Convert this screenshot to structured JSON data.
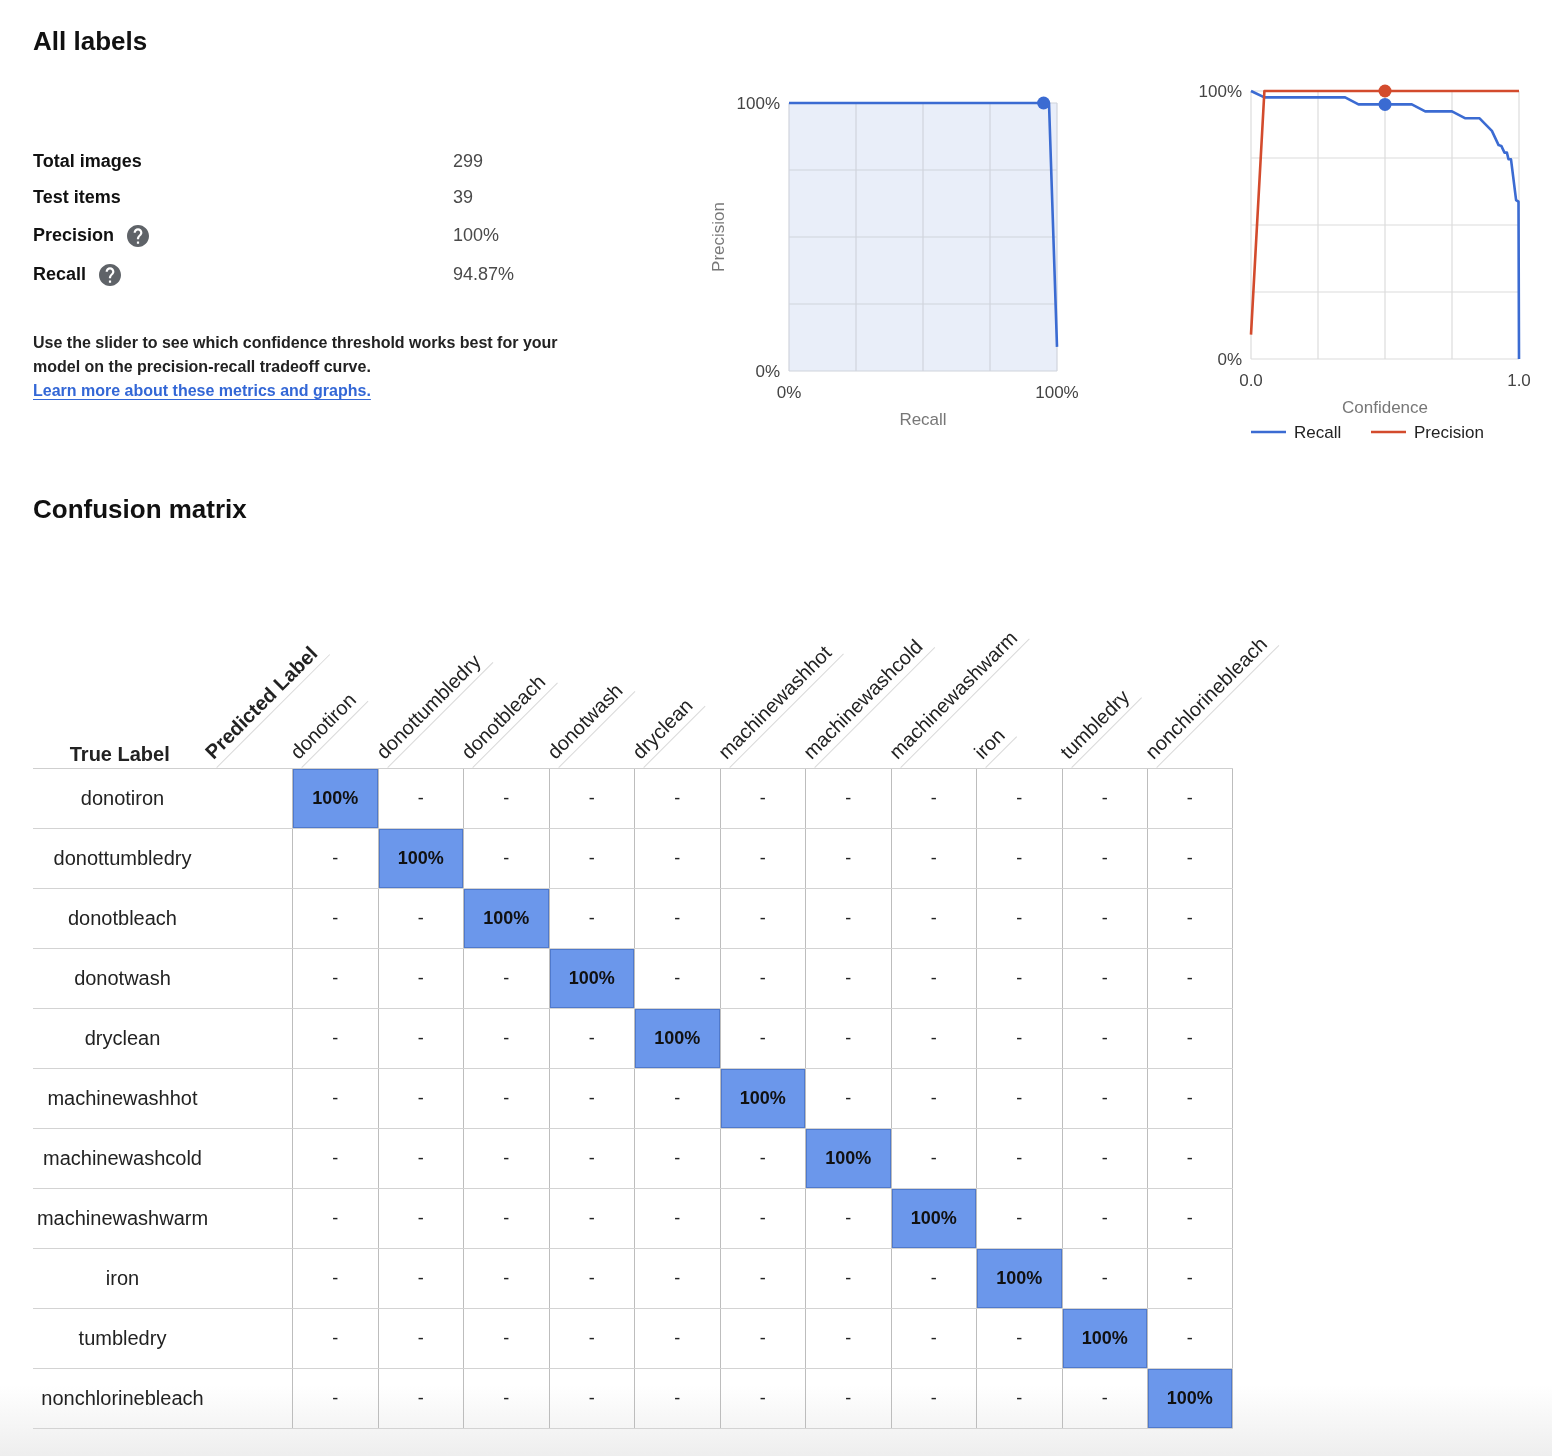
{
  "all_labels": {
    "title": "All labels",
    "metrics": [
      {
        "label": "Total images",
        "value": "299",
        "help": false
      },
      {
        "label": "Test items",
        "value": "39",
        "help": false
      },
      {
        "label": "Precision",
        "value": "100%",
        "help": true
      },
      {
        "label": "Recall",
        "value": "94.87%",
        "help": true
      }
    ],
    "description": "Use the slider to see which confidence threshold works best for your model on the precision-recall tradeoff curve.",
    "learn_more_link": "Learn more about these metrics and graphs.",
    "pr_curve": {
      "chart_data": {
        "type": "line",
        "xlabel": "Recall",
        "ylabel": "Precision",
        "x": [
          0,
          0.9487,
          0.97,
          1
        ],
        "series": [
          {
            "color": "#3b6bd2",
            "values": [
              1,
              1,
              1,
              0.09
            ]
          }
        ],
        "xlim": [
          0,
          1
        ],
        "ylim": [
          0,
          1
        ],
        "xticks": [
          {
            "value": 0,
            "label": "0%"
          },
          {
            "value": 1,
            "label": "100%"
          }
        ],
        "yticks": [
          {
            "value": 0,
            "label": "0%"
          },
          {
            "value": 1,
            "label": "100%"
          }
        ]
      }
    },
    "threshold_curve": {
      "chart_data": {
        "type": "line",
        "xlabel": "Confidence",
        "x": [
          0,
          0.05,
          0.351,
          0.401,
          0.6,
          0.65,
          0.75,
          0.8,
          0.853,
          0.899,
          0.924,
          0.934,
          0.946,
          0.955,
          0.961,
          0.97,
          0.989,
          0.998,
          1
        ],
        "series": [
          {
            "name": "Recall",
            "color": "#3b6bd2",
            "values": [
              1,
              0.976,
              0.976,
              0.95,
              0.95,
              0.924,
              0.924,
              0.898,
              0.898,
              0.851,
              0.798,
              0.795,
              0.77,
              0.77,
              0.745,
              0.745,
              0.593,
              0.587,
              0
            ]
          },
          {
            "name": "Precision",
            "color": "#d34b2d",
            "values": [
              0.091,
              1,
              1,
              1,
              1,
              1,
              1,
              1,
              1,
              1,
              1,
              1,
              1,
              1,
              1,
              1,
              1,
              1,
              1
            ]
          }
        ],
        "xlim": [
          0,
          1
        ],
        "ylim": [
          0,
          1
        ],
        "xticks": [
          {
            "value": 0,
            "label": "0.0"
          },
          {
            "value": 1,
            "label": "1.0"
          }
        ],
        "yticks": [
          {
            "value": 0,
            "label": "0%"
          },
          {
            "value": 1,
            "label": "100%"
          }
        ],
        "legend": "bottom"
      },
      "threshold_slider": {
        "level": 0.5
      }
    }
  },
  "confusion_matrix": {
    "title": "Confusion matrix",
    "corner_label": "True Label",
    "axis_label": "Predicted Label",
    "columns": [
      "donotiron",
      "donottumbledry",
      "donotbleach",
      "donotwash",
      "dryclean",
      "machinewashhot",
      "machinewashcold",
      "machinewashwarm",
      "iron",
      "tumbledry",
      "nonchlorinebleach"
    ],
    "rows": [
      {
        "label": "donotiron",
        "cells": [
          {
            "text": "100%",
            "highlighted": true
          },
          {
            "text": "-",
            "highlighted": false
          },
          {
            "text": "-",
            "highlighted": false
          },
          {
            "text": "-",
            "highlighted": false
          },
          {
            "text": "-",
            "highlighted": false
          },
          {
            "text": "-",
            "highlighted": false
          },
          {
            "text": "-",
            "highlighted": false
          },
          {
            "text": "-",
            "highlighted": false
          },
          {
            "text": "-",
            "highlighted": false
          },
          {
            "text": "-",
            "highlighted": false
          },
          {
            "text": "-",
            "highlighted": false
          }
        ]
      },
      {
        "label": "donottumbledry",
        "cells": [
          {
            "text": "-",
            "highlighted": false
          },
          {
            "text": "100%",
            "highlighted": true
          },
          {
            "text": "-",
            "highlighted": false
          },
          {
            "text": "-",
            "highlighted": false
          },
          {
            "text": "-",
            "highlighted": false
          },
          {
            "text": "-",
            "highlighted": false
          },
          {
            "text": "-",
            "highlighted": false
          },
          {
            "text": "-",
            "highlighted": false
          },
          {
            "text": "-",
            "highlighted": false
          },
          {
            "text": "-",
            "highlighted": false
          },
          {
            "text": "-",
            "highlighted": false
          }
        ]
      },
      {
        "label": "donotbleach",
        "cells": [
          {
            "text": "-",
            "highlighted": false
          },
          {
            "text": "-",
            "highlighted": false
          },
          {
            "text": "100%",
            "highlighted": true
          },
          {
            "text": "-",
            "highlighted": false
          },
          {
            "text": "-",
            "highlighted": false
          },
          {
            "text": "-",
            "highlighted": false
          },
          {
            "text": "-",
            "highlighted": false
          },
          {
            "text": "-",
            "highlighted": false
          },
          {
            "text": "-",
            "highlighted": false
          },
          {
            "text": "-",
            "highlighted": false
          },
          {
            "text": "-",
            "highlighted": false
          }
        ]
      },
      {
        "label": "donotwash",
        "cells": [
          {
            "text": "-",
            "highlighted": false
          },
          {
            "text": "-",
            "highlighted": false
          },
          {
            "text": "-",
            "highlighted": false
          },
          {
            "text": "100%",
            "highlighted": true
          },
          {
            "text": "-",
            "highlighted": false
          },
          {
            "text": "-",
            "highlighted": false
          },
          {
            "text": "-",
            "highlighted": false
          },
          {
            "text": "-",
            "highlighted": false
          },
          {
            "text": "-",
            "highlighted": false
          },
          {
            "text": "-",
            "highlighted": false
          },
          {
            "text": "-",
            "highlighted": false
          }
        ]
      },
      {
        "label": "dryclean",
        "cells": [
          {
            "text": "-",
            "highlighted": false
          },
          {
            "text": "-",
            "highlighted": false
          },
          {
            "text": "-",
            "highlighted": false
          },
          {
            "text": "-",
            "highlighted": false
          },
          {
            "text": "100%",
            "highlighted": true
          },
          {
            "text": "-",
            "highlighted": false
          },
          {
            "text": "-",
            "highlighted": false
          },
          {
            "text": "-",
            "highlighted": false
          },
          {
            "text": "-",
            "highlighted": false
          },
          {
            "text": "-",
            "highlighted": false
          },
          {
            "text": "-",
            "highlighted": false
          }
        ]
      },
      {
        "label": "machinewashhot",
        "cells": [
          {
            "text": "-",
            "highlighted": false
          },
          {
            "text": "-",
            "highlighted": false
          },
          {
            "text": "-",
            "highlighted": false
          },
          {
            "text": "-",
            "highlighted": false
          },
          {
            "text": "-",
            "highlighted": false
          },
          {
            "text": "100%",
            "highlighted": true
          },
          {
            "text": "-",
            "highlighted": false
          },
          {
            "text": "-",
            "highlighted": false
          },
          {
            "text": "-",
            "highlighted": false
          },
          {
            "text": "-",
            "highlighted": false
          },
          {
            "text": "-",
            "highlighted": false
          }
        ]
      },
      {
        "label": "machinewashcold",
        "cells": [
          {
            "text": "-",
            "highlighted": false
          },
          {
            "text": "-",
            "highlighted": false
          },
          {
            "text": "-",
            "highlighted": false
          },
          {
            "text": "-",
            "highlighted": false
          },
          {
            "text": "-",
            "highlighted": false
          },
          {
            "text": "-",
            "highlighted": false
          },
          {
            "text": "100%",
            "highlighted": true
          },
          {
            "text": "-",
            "highlighted": false
          },
          {
            "text": "-",
            "highlighted": false
          },
          {
            "text": "-",
            "highlighted": false
          },
          {
            "text": "-",
            "highlighted": false
          }
        ]
      },
      {
        "label": "machinewashwarm",
        "cells": [
          {
            "text": "-",
            "highlighted": false
          },
          {
            "text": "-",
            "highlighted": false
          },
          {
            "text": "-",
            "highlighted": false
          },
          {
            "text": "-",
            "highlighted": false
          },
          {
            "text": "-",
            "highlighted": false
          },
          {
            "text": "-",
            "highlighted": false
          },
          {
            "text": "-",
            "highlighted": false
          },
          {
            "text": "100%",
            "highlighted": true
          },
          {
            "text": "-",
            "highlighted": false
          },
          {
            "text": "-",
            "highlighted": false
          },
          {
            "text": "-",
            "highlighted": false
          }
        ]
      },
      {
        "label": "iron",
        "cells": [
          {
            "text": "-",
            "highlighted": false
          },
          {
            "text": "-",
            "highlighted": false
          },
          {
            "text": "-",
            "highlighted": false
          },
          {
            "text": "-",
            "highlighted": false
          },
          {
            "text": "-",
            "highlighted": false
          },
          {
            "text": "-",
            "highlighted": false
          },
          {
            "text": "-",
            "highlighted": false
          },
          {
            "text": "-",
            "highlighted": false
          },
          {
            "text": "100%",
            "highlighted": true
          },
          {
            "text": "-",
            "highlighted": false
          },
          {
            "text": "-",
            "highlighted": false
          }
        ]
      },
      {
        "label": "tumbledry",
        "cells": [
          {
            "text": "-",
            "highlighted": false
          },
          {
            "text": "-",
            "highlighted": false
          },
          {
            "text": "-",
            "highlighted": false
          },
          {
            "text": "-",
            "highlighted": false
          },
          {
            "text": "-",
            "highlighted": false
          },
          {
            "text": "-",
            "highlighted": false
          },
          {
            "text": "-",
            "highlighted": false
          },
          {
            "text": "-",
            "highlighted": false
          },
          {
            "text": "-",
            "highlighted": false
          },
          {
            "text": "100%",
            "highlighted": true
          },
          {
            "text": "-",
            "highlighted": false
          }
        ]
      },
      {
        "label": "nonchlorinebleach",
        "cells": [
          {
            "text": "-",
            "highlighted": false
          },
          {
            "text": "-",
            "highlighted": false
          },
          {
            "text": "-",
            "highlighted": false
          },
          {
            "text": "-",
            "highlighted": false
          },
          {
            "text": "-",
            "highlighted": false
          },
          {
            "text": "-",
            "highlighted": false
          },
          {
            "text": "-",
            "highlighted": false
          },
          {
            "text": "-",
            "highlighted": false
          },
          {
            "text": "-",
            "highlighted": false
          },
          {
            "text": "-",
            "highlighted": false
          },
          {
            "text": "100%",
            "highlighted": true
          }
        ]
      }
    ]
  }
}
